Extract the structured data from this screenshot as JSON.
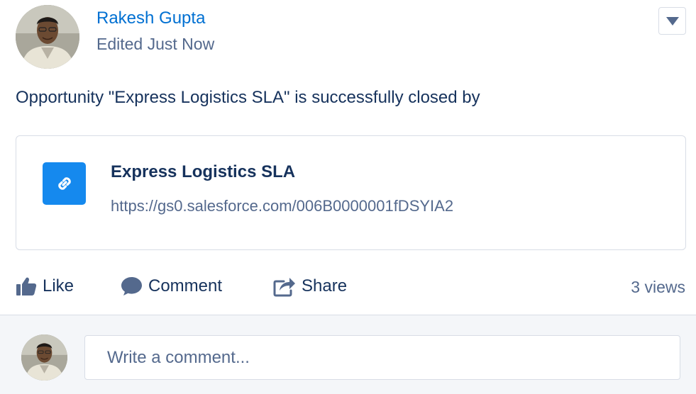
{
  "post": {
    "author": "Rakesh Gupta",
    "edited_status": "Edited Just Now",
    "body": "Opportunity \"Express Logistics SLA\" is successfully closed by"
  },
  "link_card": {
    "title": "Express Logistics SLA",
    "url": "https://gs0.salesforce.com/006B0000001fDSYIA2",
    "icon": "link-icon"
  },
  "actions": {
    "like_label": "Like",
    "comment_label": "Comment",
    "share_label": "Share",
    "views": "3 views"
  },
  "comment_box": {
    "placeholder": "Write a comment..."
  },
  "colors": {
    "brand_blue": "#0070d2",
    "link_icon_bg": "#1589ee",
    "text_dark": "#16325c",
    "text_muted": "#54698d",
    "border": "#d8dde6"
  }
}
